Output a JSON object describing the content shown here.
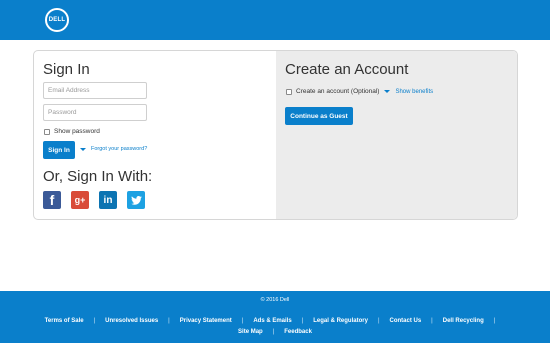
{
  "header": {
    "logo_text": "DELL"
  },
  "sign_in": {
    "title": "Sign In",
    "email_placeholder": "Email Address",
    "password_placeholder": "Password",
    "show_password_label": "Show password",
    "sign_in_button": "Sign In",
    "forgot_link": "Forgot your password?",
    "or_title": "Or, Sign In With:",
    "social": [
      {
        "icon": "facebook-icon",
        "glyph": "f"
      },
      {
        "icon": "google-plus-icon",
        "glyph": "g+"
      },
      {
        "icon": "linkedin-icon",
        "glyph": "in"
      },
      {
        "icon": "twitter-icon",
        "glyph": "t"
      }
    ]
  },
  "create_account": {
    "title": "Create an Account",
    "optional_label": "Create an account (Optional)",
    "show_benefits": "Show benefits",
    "guest_button": "Continue as Guest"
  },
  "footer": {
    "copyright": "© 2016 Dell",
    "links": [
      "Terms of Sale",
      "Unresolved Issues",
      "Privacy Statement",
      "Ads & Emails",
      "Legal & Regulatory",
      "Contact Us",
      "Dell Recycling",
      "Site Map",
      "Feedback"
    ]
  },
  "colors": {
    "brand": "#0a7fcb",
    "panel_right": "#ececec"
  }
}
